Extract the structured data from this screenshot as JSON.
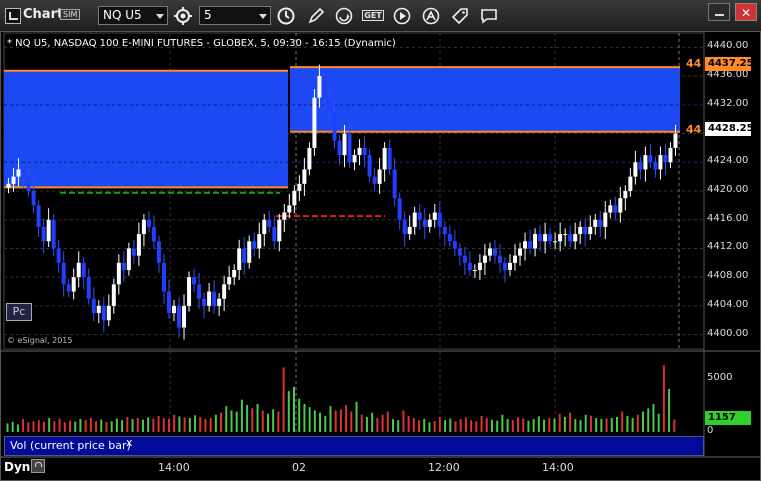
{
  "window": {
    "title": "Chart",
    "sim_badge": "SIM",
    "close_label": "✕"
  },
  "toolbar": {
    "symbol_value": "NQ U5",
    "interval_value": "5",
    "icons": [
      "settings-gear-icon",
      "clock-icon",
      "pencil-icon",
      "refresh-icon",
      "get-icon",
      "play-icon",
      "alert-icon",
      "tag-icon",
      "comment-icon"
    ],
    "get_label": "GET"
  },
  "chart": {
    "header": "* NQ U5, NASDAQ 100 E-MINI FUTURES - GLOBEX, 5, 09:30 - 16:15 (Dynamic)",
    "credit": "© eSignal, 2015",
    "pc_label": "Pc",
    "price_ticks": [
      "4440.00",
      "4436.00",
      "4432.00",
      "4428.25",
      "4424.00",
      "4420.00",
      "4416.00",
      "4412.00",
      "4408.00",
      "4404.00",
      "4400.00"
    ],
    "time_ticks": [
      "14:00",
      "02",
      "12:00",
      "14:00"
    ],
    "last_price_tag": "4428.25",
    "upper_price_tag": "4437.25",
    "left_orange_labels": [
      "44",
      "44"
    ],
    "colors": {
      "up": "#ffffff",
      "down": "#2040ff",
      "zone": "#1f4dff",
      "orange": "#ff8a2a",
      "green_dash": "#1f9b1f",
      "red_dash": "#e02020"
    }
  },
  "volume": {
    "header": "Vol (current price bar)",
    "close_label": "x",
    "ticks": [
      "5000",
      "0"
    ],
    "current_tag": "1157"
  },
  "footer": {
    "dyn_label": "Dyn"
  },
  "chart_data": {
    "type": "candlestick",
    "title": "* NQ U5, NASDAQ 100 E-MINI FUTURES - GLOBEX, 5, 09:30 - 16:15 (Dynamic)",
    "ylim": [
      4398,
      4442
    ],
    "x_labels": [
      "14:00",
      "02",
      "12:00",
      "14:00"
    ],
    "zones": [
      {
        "from": 4420.5,
        "to": 4436.75,
        "color": "#1f4dff",
        "segment": "left"
      },
      {
        "from": 4428.25,
        "to": 4437.25,
        "color": "#1f4dff",
        "segment": "right"
      }
    ],
    "levels": [
      {
        "price": 4419.75,
        "style": "dashed",
        "color": "#1f9b1f"
      },
      {
        "price": 4416.5,
        "style": "dashed",
        "color": "#e02020"
      }
    ],
    "close_series": [
      4421,
      4422,
      4423,
      4422,
      4420,
      4418,
      4415,
      4413,
      4416,
      4412,
      4410,
      4407,
      4406,
      4408,
      4410,
      4408,
      4405,
      4403,
      4404,
      4402,
      4404,
      4407,
      4410,
      4409,
      4412,
      4411,
      4414,
      4416,
      4415,
      4413,
      4410,
      4406,
      4403,
      4404,
      4401,
      4404,
      4408,
      4407,
      4405,
      4404,
      4406,
      4404,
      4405,
      4407,
      4408,
      4409,
      4412,
      4410,
      4413,
      4412,
      4414,
      4416,
      4415,
      4413,
      4416,
      4417,
      4418,
      4420,
      4421,
      4423,
      4426,
      4433,
      4436,
      4433,
      4431,
      4427,
      4425,
      4428,
      4424,
      4425,
      4426,
      4425,
      4422,
      4421,
      4423,
      4426,
      4423,
      4419,
      4416,
      4414,
      4415,
      4417,
      4416,
      4415,
      4416,
      4417,
      4415,
      4414,
      4413,
      4412,
      4411,
      4410,
      4409,
      4409,
      4410,
      4411,
      4412,
      4411,
      4410,
      4409,
      4410,
      4411,
      4412,
      4413,
      4412,
      4414,
      4413,
      4414,
      4413,
      4413,
      4414,
      4414,
      4413,
      4414,
      4415,
      4414,
      4415,
      4416,
      4415,
      4417,
      4418,
      4417,
      4419,
      4420,
      4422,
      4424,
      4423,
      4425,
      4424,
      4423,
      4425,
      4424,
      4426,
      4428
    ],
    "volume": [
      800,
      950,
      700,
      1200,
      900,
      1000,
      1100,
      950,
      1300,
      1000,
      1250,
      900,
      1050,
      950,
      1200,
      1100,
      1300,
      1000,
      1150,
      900,
      1000,
      1250,
      1100,
      1400,
      1200,
      1300,
      1150,
      1350,
      1250,
      1500,
      1300,
      1200,
      1600,
      1450,
      1350,
      1300,
      1550,
      1400,
      1200,
      1300,
      1600,
      1800,
      2400,
      2000,
      1900,
      3000,
      2500,
      2200,
      2600,
      2000,
      1700,
      2100,
      1900,
      6000,
      3800,
      4200,
      3100,
      2600,
      2300,
      2000,
      1800,
      1500,
      2400,
      2000,
      2100,
      2500,
      1900,
      2800,
      1600,
      1400,
      1800,
      1300,
      1600,
      1900,
      1200,
      1100,
      2000,
      1500,
      1300,
      1100,
      1200,
      900,
      1000,
      1400,
      1100,
      1250,
      1000,
      1200,
      1350,
      1100,
      1000,
      1500,
      1300,
      1150,
      1050,
      1600,
      1200,
      1100,
      1350,
      1250,
      1050,
      1200,
      1450,
      1150,
      1300,
      1250,
      1700,
      1400,
      1800,
      1200,
      1100,
      1600,
      1500,
      1300,
      1200,
      1250,
      1300,
      1400,
      1900,
      1500,
      1300,
      1600,
      1900,
      2200,
      2600,
      1700,
      6200,
      4000,
      1157
    ]
  }
}
